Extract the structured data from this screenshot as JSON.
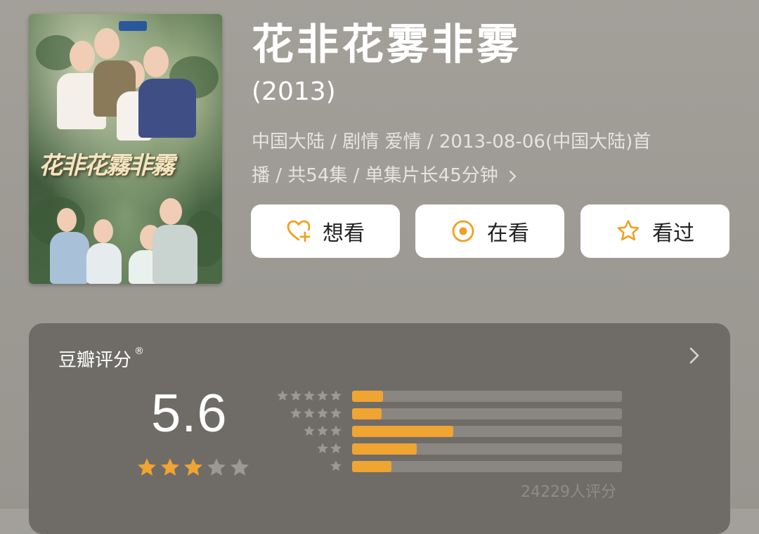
{
  "title": "花非花雾非雾",
  "year": "(2013)",
  "meta_line1": "中国大陆 / 剧情 爱情 / 2013-08-06(中国大陆)首",
  "meta_line2": "播 / 共54集 / 单集片长45分钟",
  "buttons": [
    {
      "label": "想看",
      "icon": "heart-plus-icon"
    },
    {
      "label": "在看",
      "icon": "target-circle-icon"
    },
    {
      "label": "看过",
      "icon": "star-outline-icon"
    }
  ],
  "rating": {
    "section_title": "豆瓣评分",
    "registered_mark": "®",
    "score": "5.6",
    "stars_filled": 3,
    "stars_total": 5,
    "distribution": [
      {
        "stars": 5,
        "percent": 11.5
      },
      {
        "stars": 4,
        "percent": 11
      },
      {
        "stars": 3,
        "percent": 37.5
      },
      {
        "stars": 2,
        "percent": 24
      },
      {
        "stars": 1,
        "percent": 14.5
      }
    ],
    "rating_count": "24229人评分"
  },
  "colors": {
    "accent_star": "#f0a431",
    "icon_orange": "#f0a020"
  }
}
